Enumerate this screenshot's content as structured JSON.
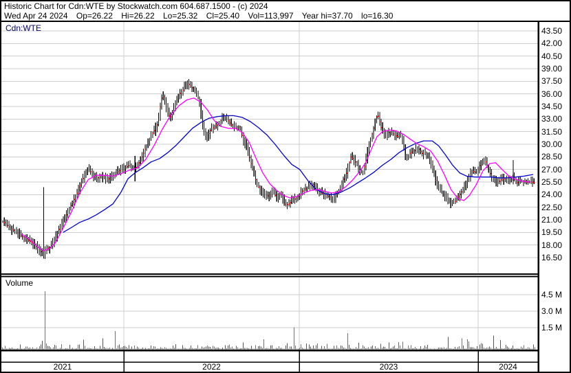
{
  "header": {
    "title_line": "Historic Chart for Cdn:WTE by Stockwatch.com 604.687.1500 - (c) 2024",
    "quote": {
      "date": "Wed Apr 24 2024",
      "open": "Op=26.22",
      "high": "Hi=26.22",
      "low": "Lo=25.32",
      "close": "Cl=25.40",
      "volume": "Vol=113,997",
      "year_high": "Year hi=37.70",
      "year_low": "lo=16.30"
    }
  },
  "price_panel": {
    "symbol_label": "Cdn:WTE"
  },
  "volume_panel": {
    "label": "Volume"
  },
  "axes": {
    "price_ticks": [
      "43.50",
      "42.00",
      "40.50",
      "39.00",
      "37.50",
      "36.00",
      "34.50",
      "33.00",
      "31.50",
      "30.00",
      "28.50",
      "27.00",
      "25.50",
      "24.00",
      "22.50",
      "21.00",
      "19.50",
      "18.00",
      "16.50"
    ],
    "volume_ticks": [
      "4.5 M",
      "3.0 M",
      "1.5 M"
    ],
    "years": [
      "2021",
      "2022",
      "2023",
      "2024"
    ]
  },
  "colors": {
    "candle": "#000000",
    "candle_tick": "#ff0000",
    "ma_short": "#ff00ff",
    "ma_long": "#0000cd",
    "vol_up": "#27a127",
    "vol_down": "#d62020",
    "grid": "#cccccc",
    "border": "#000000",
    "symbol_text": "#000066"
  },
  "chart_data": {
    "type": "candlestick",
    "symbol": "Cdn:WTE",
    "title": "Historic Chart for Cdn:WTE",
    "x_axis_years": [
      "2021",
      "2022",
      "2023",
      "2024"
    ],
    "year_boundaries_f": [
      0.228,
      0.555,
      0.888
    ],
    "price_ylim": [
      14.5,
      44.6
    ],
    "price_grid_step": 1.5,
    "price_tick_values": [
      43.5,
      42.0,
      40.5,
      39.0,
      37.5,
      36.0,
      34.5,
      33.0,
      31.5,
      30.0,
      28.5,
      27.0,
      25.5,
      24.0,
      22.5,
      21.0,
      19.5,
      18.0,
      16.5
    ],
    "volume_tick_values_m": [
      4.5,
      3.0,
      1.5
    ],
    "last_quote": {
      "open": 26.22,
      "high": 26.22,
      "low": 25.32,
      "close": 25.4,
      "volume": 113997,
      "year_high": 37.7,
      "year_low": 16.3
    },
    "series": {
      "close": [
        [
          0.003,
          20.8
        ],
        [
          0.013,
          20.2
        ],
        [
          0.023,
          19.7
        ],
        [
          0.033,
          19.2
        ],
        [
          0.044,
          18.8
        ],
        [
          0.054,
          18.4
        ],
        [
          0.064,
          17.9
        ],
        [
          0.072,
          17.3
        ],
        [
          0.078,
          16.8
        ],
        [
          0.082,
          17.5
        ],
        [
          0.09,
          17.7
        ],
        [
          0.1,
          18.9
        ],
        [
          0.11,
          20.3
        ],
        [
          0.121,
          21.6
        ],
        [
          0.131,
          22.9
        ],
        [
          0.141,
          24.2
        ],
        [
          0.151,
          25.8
        ],
        [
          0.162,
          27.2
        ],
        [
          0.169,
          26.4
        ],
        [
          0.177,
          25.9
        ],
        [
          0.187,
          26.2
        ],
        [
          0.197,
          25.7
        ],
        [
          0.208,
          26.4
        ],
        [
          0.218,
          26.8
        ],
        [
          0.228,
          27.1
        ],
        [
          0.238,
          27.5
        ],
        [
          0.249,
          27.1
        ],
        [
          0.259,
          28.0
        ],
        [
          0.269,
          29.6
        ],
        [
          0.279,
          31.0
        ],
        [
          0.29,
          32.2
        ],
        [
          0.3,
          36.0
        ],
        [
          0.308,
          34.2
        ],
        [
          0.315,
          33.1
        ],
        [
          0.323,
          34.8
        ],
        [
          0.331,
          36.0
        ],
        [
          0.338,
          36.4
        ],
        [
          0.346,
          37.4
        ],
        [
          0.354,
          36.8
        ],
        [
          0.362,
          36.4
        ],
        [
          0.369,
          35.0
        ],
        [
          0.376,
          31.8
        ],
        [
          0.382,
          30.7
        ],
        [
          0.39,
          31.8
        ],
        [
          0.397,
          32.1
        ],
        [
          0.405,
          32.5
        ],
        [
          0.413,
          33.2
        ],
        [
          0.421,
          33.0
        ],
        [
          0.428,
          32.3
        ],
        [
          0.436,
          31.9
        ],
        [
          0.444,
          32.1
        ],
        [
          0.451,
          30.4
        ],
        [
          0.459,
          29.3
        ],
        [
          0.467,
          27.2
        ],
        [
          0.474,
          25.7
        ],
        [
          0.482,
          24.5
        ],
        [
          0.49,
          24.2
        ],
        [
          0.497,
          23.8
        ],
        [
          0.505,
          24.4
        ],
        [
          0.513,
          23.7
        ],
        [
          0.521,
          24.1
        ],
        [
          0.528,
          22.7
        ],
        [
          0.536,
          22.9
        ],
        [
          0.544,
          23.4
        ],
        [
          0.551,
          23.6
        ],
        [
          0.559,
          24.3
        ],
        [
          0.567,
          24.7
        ],
        [
          0.574,
          25.0
        ],
        [
          0.582,
          25.2
        ],
        [
          0.59,
          24.5
        ],
        [
          0.597,
          24.2
        ],
        [
          0.605,
          23.9
        ],
        [
          0.613,
          23.7
        ],
        [
          0.621,
          23.6
        ],
        [
          0.628,
          24.4
        ],
        [
          0.636,
          25.7
        ],
        [
          0.644,
          26.7
        ],
        [
          0.651,
          28.5
        ],
        [
          0.659,
          28.0
        ],
        [
          0.667,
          26.9
        ],
        [
          0.674,
          26.5
        ],
        [
          0.682,
          29.0
        ],
        [
          0.69,
          31.0
        ],
        [
          0.697,
          32.8
        ],
        [
          0.701,
          33.6
        ],
        [
          0.708,
          31.9
        ],
        [
          0.715,
          30.9
        ],
        [
          0.723,
          31.5
        ],
        [
          0.731,
          31.2
        ],
        [
          0.738,
          30.9
        ],
        [
          0.746,
          31.1
        ],
        [
          0.754,
          28.2
        ],
        [
          0.762,
          29.0
        ],
        [
          0.769,
          29.2
        ],
        [
          0.777,
          29.5
        ],
        [
          0.785,
          28.8
        ],
        [
          0.792,
          28.9
        ],
        [
          0.8,
          27.9
        ],
        [
          0.808,
          25.9
        ],
        [
          0.815,
          24.8
        ],
        [
          0.823,
          24.1
        ],
        [
          0.831,
          23.5
        ],
        [
          0.838,
          22.9
        ],
        [
          0.846,
          23.2
        ],
        [
          0.854,
          24.0
        ],
        [
          0.862,
          24.8
        ],
        [
          0.869,
          26.0
        ],
        [
          0.877,
          26.8
        ],
        [
          0.885,
          26.6
        ],
        [
          0.892,
          27.6
        ],
        [
          0.9,
          28.3
        ],
        [
          0.908,
          26.9
        ],
        [
          0.915,
          25.9
        ],
        [
          0.923,
          25.3
        ],
        [
          0.931,
          25.8
        ],
        [
          0.938,
          25.9
        ],
        [
          0.946,
          25.7
        ],
        [
          0.954,
          26.0
        ],
        [
          0.962,
          25.4
        ],
        [
          0.969,
          25.6
        ],
        [
          0.977,
          25.4
        ],
        [
          0.985,
          25.6
        ],
        [
          0.992,
          25.4
        ]
      ],
      "ma_short_magenta": [
        [
          0.038,
          19.3
        ],
        [
          0.054,
          18.6
        ],
        [
          0.069,
          17.7
        ],
        [
          0.079,
          17.3
        ],
        [
          0.09,
          17.6
        ],
        [
          0.1,
          18.2
        ],
        [
          0.115,
          20.0
        ],
        [
          0.131,
          22.0
        ],
        [
          0.146,
          24.2
        ],
        [
          0.162,
          25.8
        ],
        [
          0.177,
          26.3
        ],
        [
          0.192,
          26.3
        ],
        [
          0.208,
          26.2
        ],
        [
          0.223,
          26.5
        ],
        [
          0.238,
          26.9
        ],
        [
          0.254,
          27.2
        ],
        [
          0.269,
          28.2
        ],
        [
          0.285,
          29.9
        ],
        [
          0.3,
          31.8
        ],
        [
          0.315,
          33.4
        ],
        [
          0.331,
          34.6
        ],
        [
          0.346,
          35.3
        ],
        [
          0.359,
          35.5
        ],
        [
          0.372,
          35.0
        ],
        [
          0.385,
          34.0
        ],
        [
          0.397,
          32.8
        ],
        [
          0.41,
          32.1
        ],
        [
          0.423,
          31.9
        ],
        [
          0.436,
          31.9
        ],
        [
          0.449,
          31.4
        ],
        [
          0.462,
          30.2
        ],
        [
          0.474,
          28.4
        ],
        [
          0.487,
          26.6
        ],
        [
          0.5,
          25.3
        ],
        [
          0.513,
          24.5
        ],
        [
          0.526,
          23.9
        ],
        [
          0.538,
          23.6
        ],
        [
          0.551,
          23.8
        ],
        [
          0.564,
          24.2
        ],
        [
          0.577,
          24.5
        ],
        [
          0.59,
          24.6
        ],
        [
          0.603,
          24.4
        ],
        [
          0.615,
          24.2
        ],
        [
          0.628,
          24.3
        ],
        [
          0.641,
          24.9
        ],
        [
          0.654,
          25.7
        ],
        [
          0.667,
          26.7
        ],
        [
          0.679,
          27.8
        ],
        [
          0.69,
          29.5
        ],
        [
          0.7,
          30.9
        ],
        [
          0.71,
          31.5
        ],
        [
          0.723,
          31.7
        ],
        [
          0.736,
          31.6
        ],
        [
          0.749,
          31.2
        ],
        [
          0.762,
          30.6
        ],
        [
          0.774,
          30.1
        ],
        [
          0.787,
          29.7
        ],
        [
          0.8,
          29.2
        ],
        [
          0.813,
          28.0
        ],
        [
          0.826,
          26.3
        ],
        [
          0.838,
          24.6
        ],
        [
          0.851,
          23.5
        ],
        [
          0.862,
          23.3
        ],
        [
          0.872,
          23.9
        ],
        [
          0.885,
          25.2
        ],
        [
          0.897,
          26.8
        ],
        [
          0.91,
          27.7
        ],
        [
          0.921,
          27.8
        ],
        [
          0.933,
          27.0
        ],
        [
          0.946,
          26.2
        ],
        [
          0.959,
          25.8
        ],
        [
          0.972,
          25.6
        ],
        [
          0.987,
          25.5
        ]
      ],
      "ma_long_blue": [
        [
          0.115,
          19.5
        ],
        [
          0.131,
          20.1
        ],
        [
          0.146,
          20.7
        ],
        [
          0.162,
          21.1
        ],
        [
          0.177,
          21.6
        ],
        [
          0.192,
          22.2
        ],
        [
          0.208,
          22.9
        ],
        [
          0.223,
          24.3
        ],
        [
          0.236,
          25.9
        ],
        [
          0.249,
          26.6
        ],
        [
          0.264,
          27.2
        ],
        [
          0.279,
          27.9
        ],
        [
          0.295,
          28.3
        ],
        [
          0.31,
          29.0
        ],
        [
          0.326,
          29.9
        ],
        [
          0.341,
          30.9
        ],
        [
          0.356,
          31.9
        ],
        [
          0.372,
          32.6
        ],
        [
          0.387,
          33.1
        ],
        [
          0.403,
          33.3
        ],
        [
          0.418,
          33.4
        ],
        [
          0.433,
          33.4
        ],
        [
          0.449,
          33.2
        ],
        [
          0.464,
          32.7
        ],
        [
          0.479,
          32.0
        ],
        [
          0.495,
          31.1
        ],
        [
          0.51,
          30.0
        ],
        [
          0.526,
          28.7
        ],
        [
          0.541,
          27.6
        ],
        [
          0.556,
          27.0
        ],
        [
          0.572,
          25.6
        ],
        [
          0.587,
          24.6
        ],
        [
          0.603,
          24.1
        ],
        [
          0.618,
          24.0
        ],
        [
          0.633,
          24.3
        ],
        [
          0.649,
          24.8
        ],
        [
          0.664,
          25.4
        ],
        [
          0.679,
          26.0
        ],
        [
          0.695,
          26.7
        ],
        [
          0.71,
          27.5
        ],
        [
          0.726,
          28.2
        ],
        [
          0.741,
          29.0
        ],
        [
          0.756,
          29.6
        ],
        [
          0.772,
          30.1
        ],
        [
          0.787,
          30.4
        ],
        [
          0.803,
          30.4
        ],
        [
          0.815,
          29.8
        ],
        [
          0.828,
          28.7
        ],
        [
          0.841,
          27.5
        ],
        [
          0.854,
          26.6
        ],
        [
          0.867,
          26.2
        ],
        [
          0.882,
          26.1
        ],
        [
          0.897,
          26.1
        ],
        [
          0.913,
          26.1
        ],
        [
          0.928,
          26.0
        ],
        [
          0.944,
          26.0
        ],
        [
          0.959,
          26.1
        ],
        [
          0.974,
          26.2
        ],
        [
          0.991,
          26.4
        ]
      ]
    },
    "wick_events": [
      {
        "f": 0.079,
        "low": 16.6,
        "high": 24.9
      },
      {
        "f": 0.249,
        "low": 25.6,
        "high": 28.6
      },
      {
        "f": 0.954,
        "low": 25.2,
        "high": 28.1
      }
    ],
    "volume_spikes_m": [
      {
        "f": 0.081,
        "v_m": 5.0,
        "color": "green"
      },
      {
        "f": 0.213,
        "v_m": 1.6,
        "color": "green"
      },
      {
        "f": 0.546,
        "v_m": 1.9,
        "color": "green"
      },
      {
        "f": 0.645,
        "v_m": 1.4,
        "color": "green"
      },
      {
        "f": 0.918,
        "v_m": 1.2,
        "color": "red"
      }
    ]
  }
}
